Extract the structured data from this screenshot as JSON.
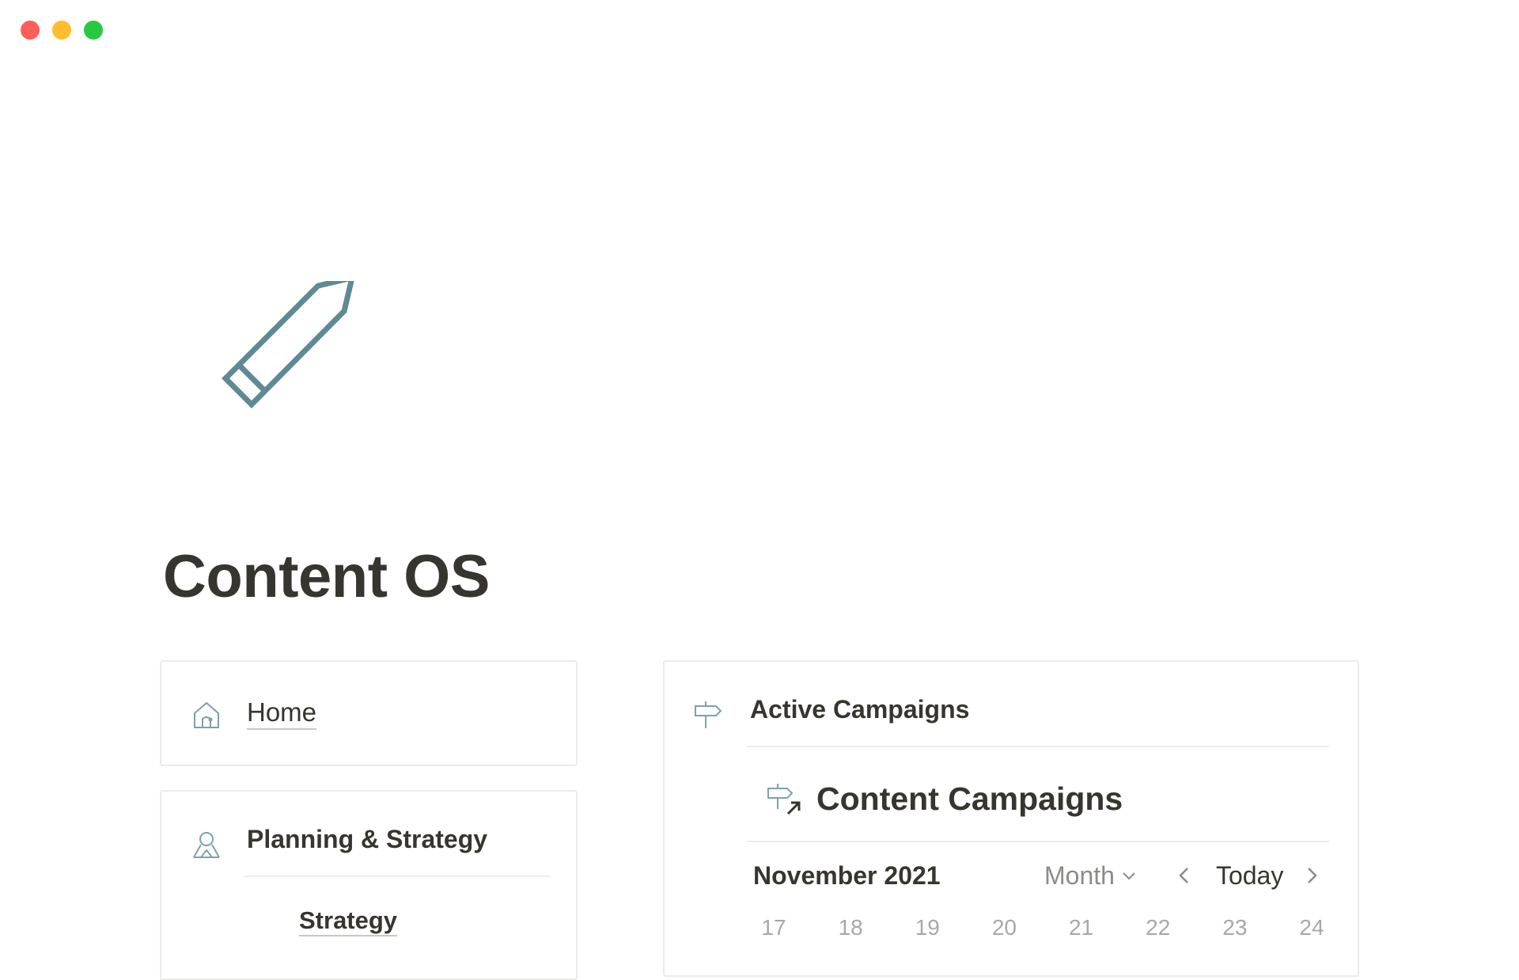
{
  "window": {
    "controls": [
      "close",
      "minimize",
      "zoom"
    ],
    "colors": {
      "close": "#fe5f57",
      "minimize": "#febc2e",
      "zoom": "#28c840"
    }
  },
  "page": {
    "icon": "pencil-icon",
    "icon_color": "#5e8a94",
    "title": "Content OS"
  },
  "home_card": {
    "icon": "house-icon",
    "link_label": "Home"
  },
  "planning_card": {
    "icon": "person-icon",
    "heading": "Planning & Strategy",
    "links": [
      "Strategy"
    ]
  },
  "campaigns_card": {
    "icon": "signpost-icon",
    "heading": "Active Campaigns",
    "database": {
      "icon": "signpost-link-icon",
      "title": "Content Campaigns"
    },
    "calendar": {
      "month_label": "November 2021",
      "view": "Month",
      "today_label": "Today",
      "days": [
        "17",
        "18",
        "19",
        "20",
        "21",
        "22",
        "23",
        "24"
      ]
    }
  }
}
